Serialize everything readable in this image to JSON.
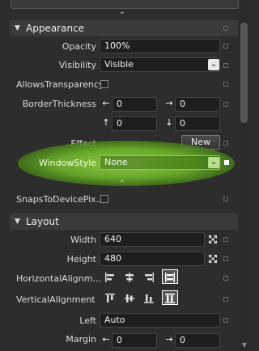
{
  "appearance": {
    "title": "Appearance",
    "opacity_label": "Opacity",
    "opacity_value": "100%",
    "visibility_label": "Visibility",
    "visibility_value": "Visible",
    "allows_transparency_label": "AllowsTransparency",
    "border_thickness_label": "BorderThickness",
    "border_left": "0",
    "border_right": "0",
    "border_top": "0",
    "border_bottom": "0",
    "effect_label": "Effect",
    "new_button": "New",
    "window_style_label": "WindowStyle",
    "window_style_value": "None",
    "snaps_label": "SnapsToDevicePix..."
  },
  "layout": {
    "title": "Layout",
    "width_label": "Width",
    "width_value": "640",
    "height_label": "Height",
    "height_value": "480",
    "horizontal_label": "HorizontalAlignm...",
    "vertical_label": "VerticalAlignment",
    "left_label": "Left",
    "left_value": "Auto",
    "margin_label": "Margin",
    "margin_left": "0",
    "margin_right": "0"
  },
  "colors": {
    "highlight_green": "#7ec03a",
    "panel_bg": "#2d2d2d",
    "section_bg": "#3a3a3a"
  }
}
